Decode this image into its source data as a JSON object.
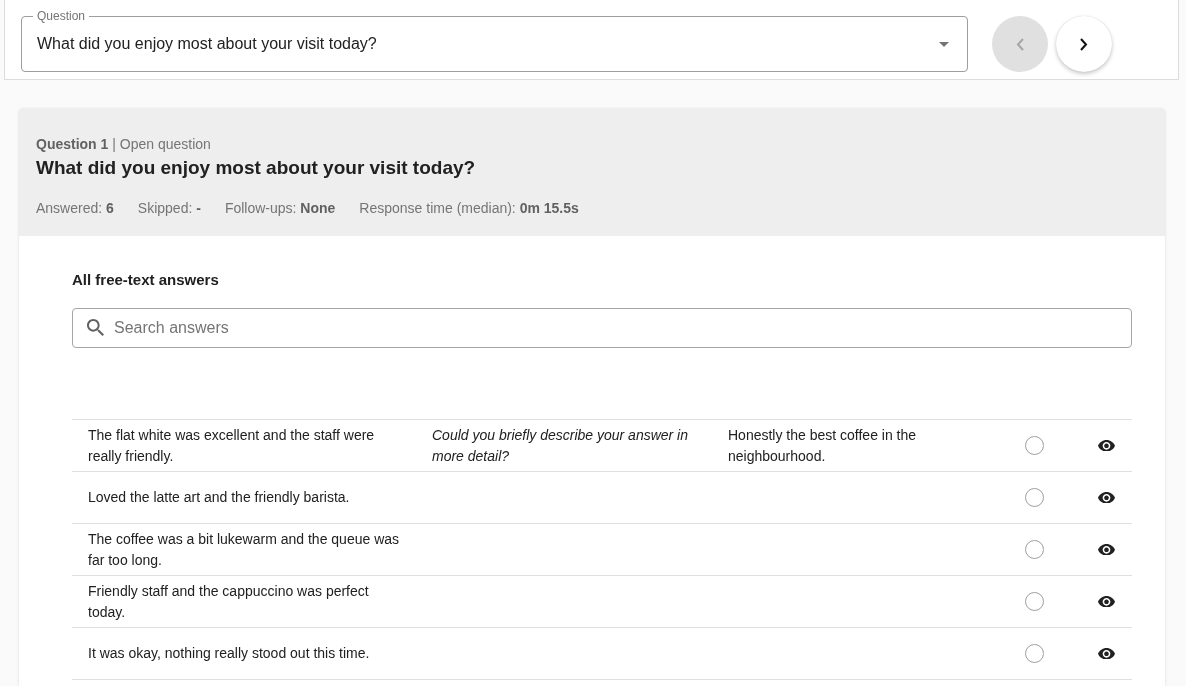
{
  "question_select": {
    "label": "Question",
    "value": "What did you enjoy most about your visit today?"
  },
  "navigation": [
    {
      "kind": "previous",
      "disabled": true
    },
    {
      "kind": "next",
      "disabled": false
    }
  ],
  "question_card": {
    "heading": "**Question 1** | Open question",
    "title": "What did you enjoy most about your visit today?",
    "stats": [
      "Answered: **6**",
      "Skipped: **-**",
      "Follow-ups: **None**",
      "Response time (median): **0m 15.5s**"
    ]
  },
  "answers": {
    "title": "All free-text answers",
    "search": {
      "placeholder": "Search answers"
    },
    "rows": [
      {
        "answer": "The flat white was excellent and the staff were really friendly.",
        "follow_up_question": "Could you briefly describe your answer in more detail?",
        "follow_up_answer": "Honestly the best coffee in the neighbourhood.",
        "selected": false
      },
      {
        "answer": "Loved the latte art and the friendly barista.",
        "selected": false
      },
      {
        "answer": "The coffee was a bit lukewarm and the queue was far too long.",
        "selected": false
      },
      {
        "answer": "Friendly staff and the cappuccino was perfect today.",
        "selected": false
      },
      {
        "answer": "It was okay, nothing really stood out this time.",
        "selected": false
      }
    ]
  }
}
